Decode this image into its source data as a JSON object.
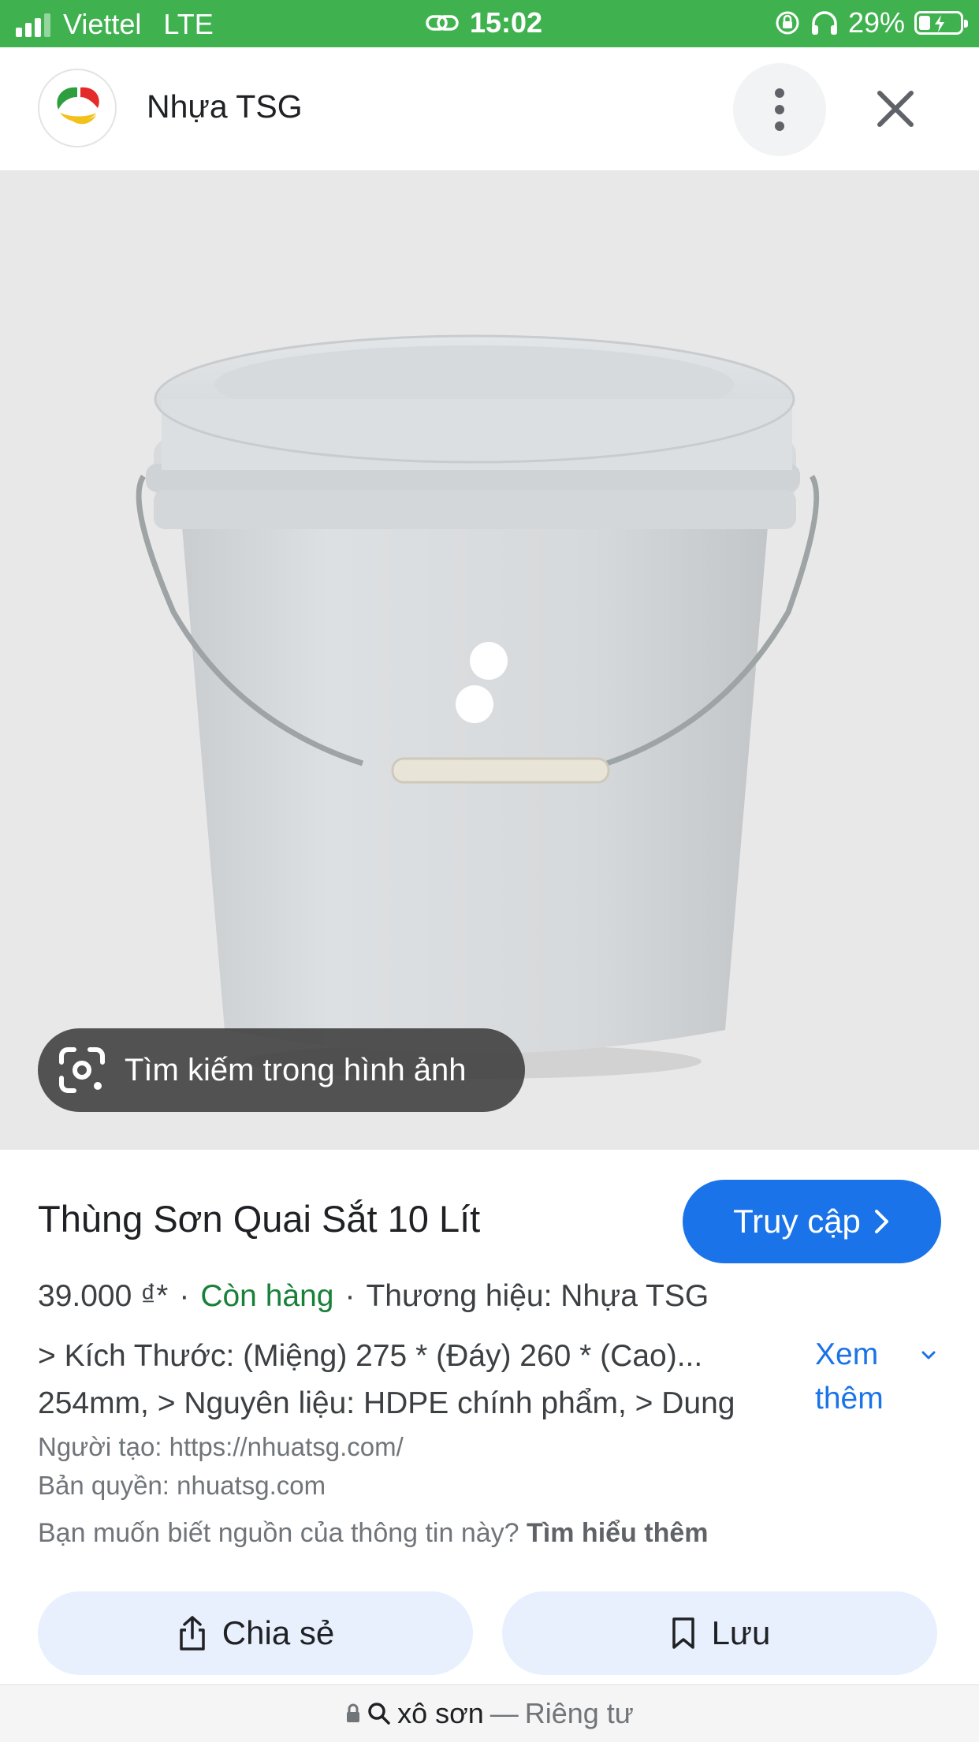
{
  "status_bar": {
    "carrier": "Viettel",
    "network": "LTE",
    "time": "15:02",
    "battery_percent": "29%",
    "battery_level": 0.29
  },
  "header": {
    "site_name": "Nhựa TSG",
    "logo_icon": "nhua-tsg-logo",
    "more_icon": "more-vert-icon",
    "close_icon": "close-icon"
  },
  "image": {
    "subject": "product-photo-bucket",
    "lens_chip_label": "Tìm kiếm trong hình ảnh"
  },
  "product": {
    "title": "Thùng Sơn Quai Sắt 10 Lít",
    "visit_label": "Truy cập",
    "price": "39.000 ₫*",
    "stock": "Còn hàng",
    "brand": "Thương hiệu: Nhựa TSG",
    "description_line1": "> Kích Thước: (Miệng) 275 * (Đáy) 260 * (Cao)...",
    "description_line2": "254mm, > Nguyên liệu: HDPE chính phẩm, > Dung",
    "more_label": "Xem thêm",
    "creator": "Người tạo: https://nhuatsg.com/",
    "copyright": "Bản quyền: nhuatsg.com",
    "source_question": "Bạn muốn biết nguồn của thông tin này?",
    "learn_more": "Tìm hiểu thêm"
  },
  "actions": {
    "share_label": "Chia sẻ",
    "save_label": "Lưu"
  },
  "url_bar": {
    "query": "xô sơn",
    "separator": "—",
    "mode": "Riêng tư"
  },
  "colors": {
    "status_bar": "#3fb24f",
    "accent": "#1a73e8",
    "in_stock": "#188038",
    "action_bg": "#e8f0fe"
  }
}
